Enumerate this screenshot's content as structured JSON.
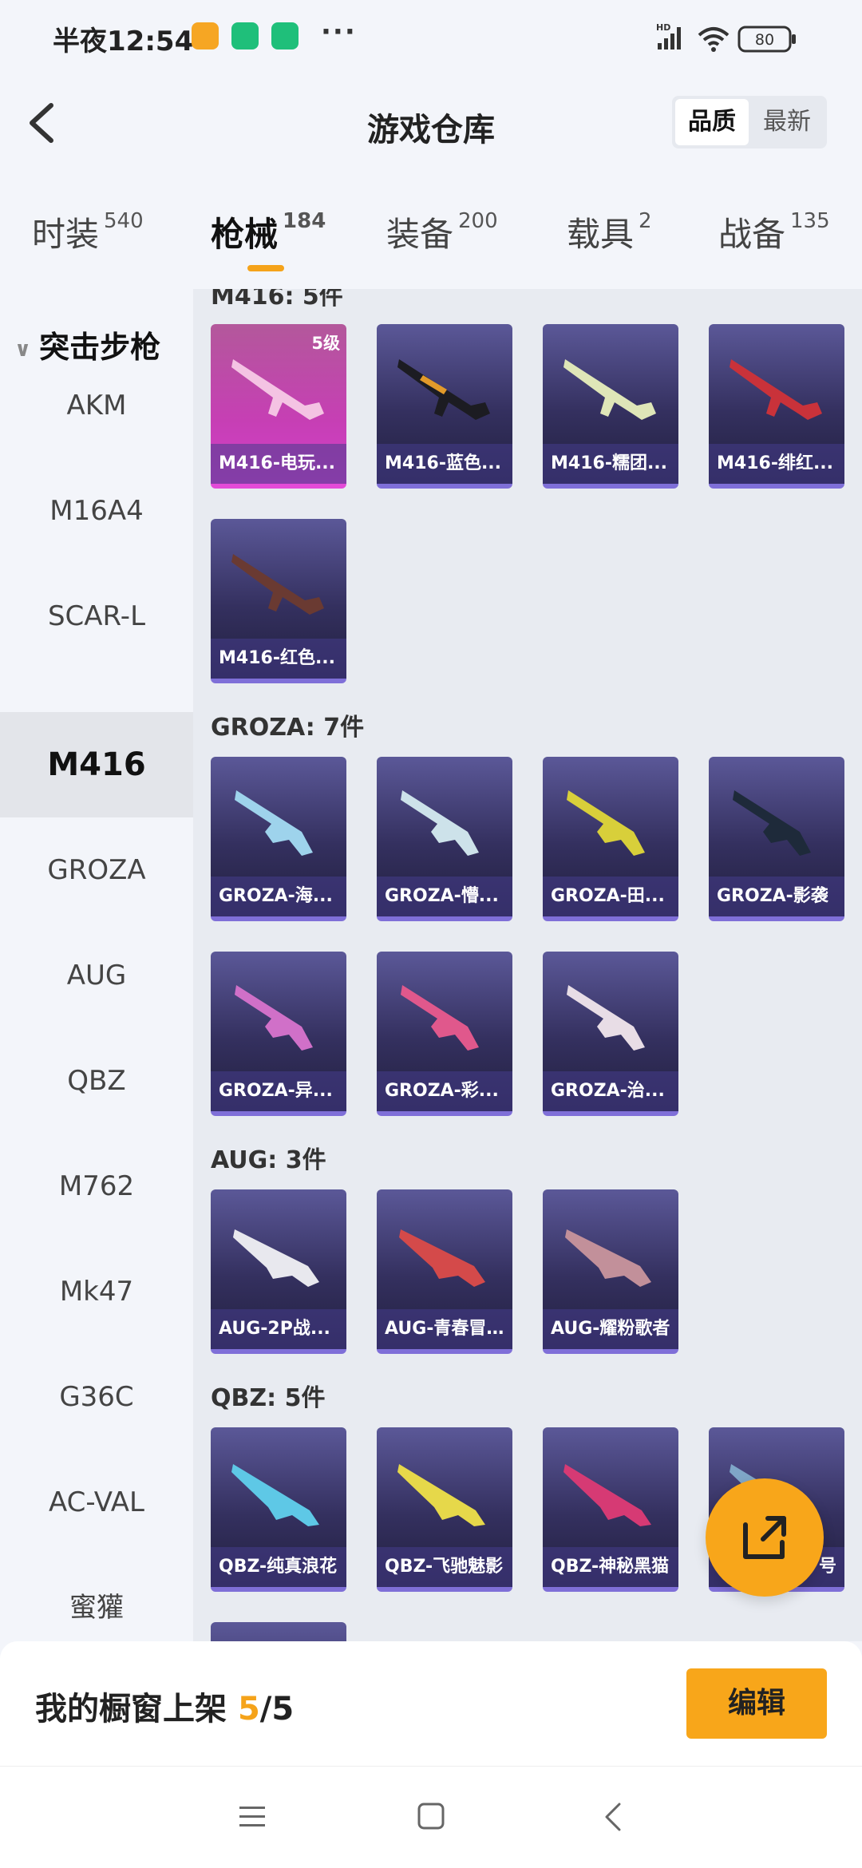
{
  "status": {
    "time": "半夜12:54",
    "battery": "80",
    "network": "HD",
    "more": "···"
  },
  "header": {
    "title": "游戏仓库",
    "sort_quality": "品质",
    "sort_newest": "最新"
  },
  "tabs": [
    {
      "label": "时装",
      "count": "540"
    },
    {
      "label": "枪械",
      "count": "184"
    },
    {
      "label": "装备",
      "count": "200"
    },
    {
      "label": "载具",
      "count": "2"
    },
    {
      "label": "战备",
      "count": "135"
    }
  ],
  "sidebar": {
    "category": "突击步枪",
    "items": [
      "AKM",
      "M16A4",
      "SCAR-L",
      "M416",
      "GROZA",
      "AUG",
      "QBZ",
      "M762",
      "Mk47",
      "G36C",
      "AC-VAL",
      "蜜獾"
    ]
  },
  "sections": [
    {
      "title": "M416: 5件",
      "items": [
        {
          "label": "M416-电玩...",
          "level": "5级"
        },
        {
          "label": "M416-蓝色..."
        },
        {
          "label": "M416-糯团..."
        },
        {
          "label": "M416-绯红..."
        },
        {
          "label": "M416-红色..."
        }
      ]
    },
    {
      "title": "GROZA: 7件",
      "items": [
        {
          "label": "GROZA-海..."
        },
        {
          "label": "GROZA-懵..."
        },
        {
          "label": "GROZA-田..."
        },
        {
          "label": "GROZA-影袭"
        },
        {
          "label": "GROZA-异..."
        },
        {
          "label": "GROZA-彩..."
        },
        {
          "label": "GROZA-治..."
        }
      ]
    },
    {
      "title": "AUG: 3件",
      "items": [
        {
          "label": "AUG-2P战..."
        },
        {
          "label": "AUG-青春冒..."
        },
        {
          "label": "AUG-耀粉歌者"
        }
      ]
    },
    {
      "title": "QBZ: 5件",
      "items": [
        {
          "label": "QBZ-纯真浪花"
        },
        {
          "label": "QBZ-飞驰魅影"
        },
        {
          "label": "QBZ-神秘黑猫"
        },
        {
          "label": "号"
        }
      ]
    }
  ],
  "showcase": {
    "prefix": "我的橱窗上架",
    "current": "5",
    "sep": "/",
    "total": "5",
    "edit": "编辑"
  },
  "colors": {
    "accent": "#f8a61a",
    "card_dark": "#34305f",
    "card_pink": "#d33fca"
  }
}
